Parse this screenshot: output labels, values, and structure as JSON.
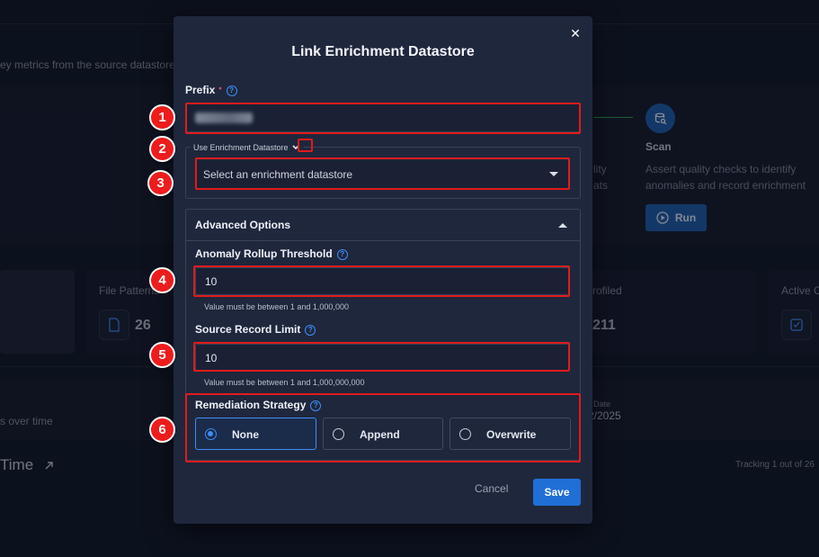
{
  "background": {
    "subtitle": "ey metrics from the source datastore",
    "scan": {
      "icon": "database-search-icon",
      "title": "Scan",
      "description": "Assert quality checks to identify anomalies and record enrichment",
      "run_label": "Run"
    },
    "truncated_desc": "lity\nats",
    "cards": [
      {
        "label": "File Patterns",
        "value": "26",
        "icon": "file-icon"
      },
      {
        "label": "rofiled",
        "value": "211"
      },
      {
        "label": "Active C",
        "icon": "checklist-icon"
      }
    ],
    "strip": {
      "left_text": "s over time",
      "date_label": "Date",
      "date_value": "2/2025"
    },
    "time_title": "Time",
    "tracking": "Tracking 1 out of 26"
  },
  "modal": {
    "title": "Link Enrichment Datastore",
    "close_icon": "close-icon",
    "prefix": {
      "label": "Prefix",
      "required_mark": "•",
      "value_blurred": true
    },
    "enrichment": {
      "legend": "Use Enrichment Datastore",
      "placeholder": "Select an enrichment datastore"
    },
    "advanced": {
      "title": "Advanced Options",
      "anomaly_rollup": {
        "label": "Anomaly Rollup Threshold",
        "value": "10",
        "hint": "Value must be between 1 and 1,000,000"
      },
      "source_record_limit": {
        "label": "Source Record Limit",
        "value": "10",
        "hint": "Value must be between 1 and 1,000,000,000"
      },
      "remediation": {
        "label": "Remediation Strategy",
        "options": [
          {
            "label": "None",
            "selected": true
          },
          {
            "label": "Append",
            "selected": false
          },
          {
            "label": "Overwrite",
            "selected": false
          }
        ]
      }
    },
    "cancel_label": "Cancel",
    "save_label": "Save"
  },
  "annotations": [
    "1",
    "2",
    "3",
    "4",
    "5",
    "6"
  ],
  "colors": {
    "annotation_red": "#e01b1b",
    "accent_blue": "#1f6fd6",
    "modal_bg": "#1f273d",
    "page_bg": "#121829"
  }
}
